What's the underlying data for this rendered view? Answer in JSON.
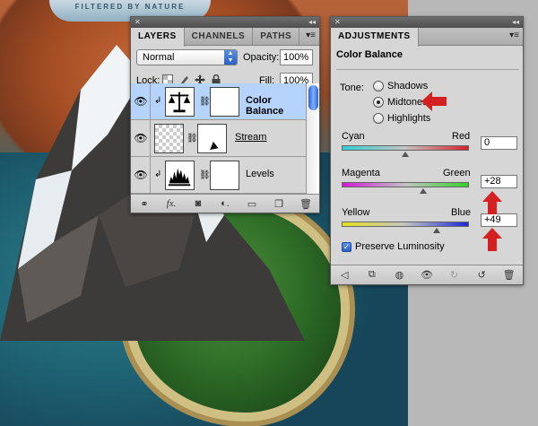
{
  "canvas": {
    "bottle_label": "FILTERED BY NATURE"
  },
  "layers_panel": {
    "tabs": [
      "LAYERS",
      "CHANNELS",
      "PATHS"
    ],
    "blend_mode": "Normal",
    "opacity_label": "Opacity:",
    "opacity_value": "100%",
    "lock_label": "Lock:",
    "fill_label": "Fill:",
    "fill_value": "100%",
    "layers": [
      {
        "name": "Color Balance",
        "selected": true
      },
      {
        "name": "Stream",
        "selected": false
      },
      {
        "name": "Levels",
        "selected": false
      }
    ],
    "bottom_icons": [
      "link-icon",
      "fx-icon",
      "mask-icon",
      "adjustment-icon",
      "group-icon",
      "new-layer-icon",
      "trash-icon"
    ]
  },
  "adjustments_panel": {
    "tab": "ADJUSTMENTS",
    "title": "Color Balance",
    "tone_label": "Tone:",
    "tone_options": [
      "Shadows",
      "Midtones",
      "Highlights"
    ],
    "selected_tone": "Midtones",
    "sliders": [
      {
        "left": "Cyan",
        "right": "Red",
        "value": "0",
        "position": 0.5
      },
      {
        "left": "Magenta",
        "right": "Green",
        "value": "+28",
        "position": 0.64
      },
      {
        "left": "Yellow",
        "right": "Blue",
        "value": "+49",
        "position": 0.745
      }
    ],
    "preserve_label": "Preserve Luminosity",
    "preserve_checked": true,
    "bottom_icons": [
      "back-arrow-icon",
      "expand-view-icon",
      "clip-layer-icon",
      "visibility-eye-icon",
      "view-previous-icon",
      "reset-icon",
      "trash-icon"
    ]
  },
  "colors": {
    "selected_layer": "#b6d3fb",
    "annotation_arrow": "#d42020"
  }
}
